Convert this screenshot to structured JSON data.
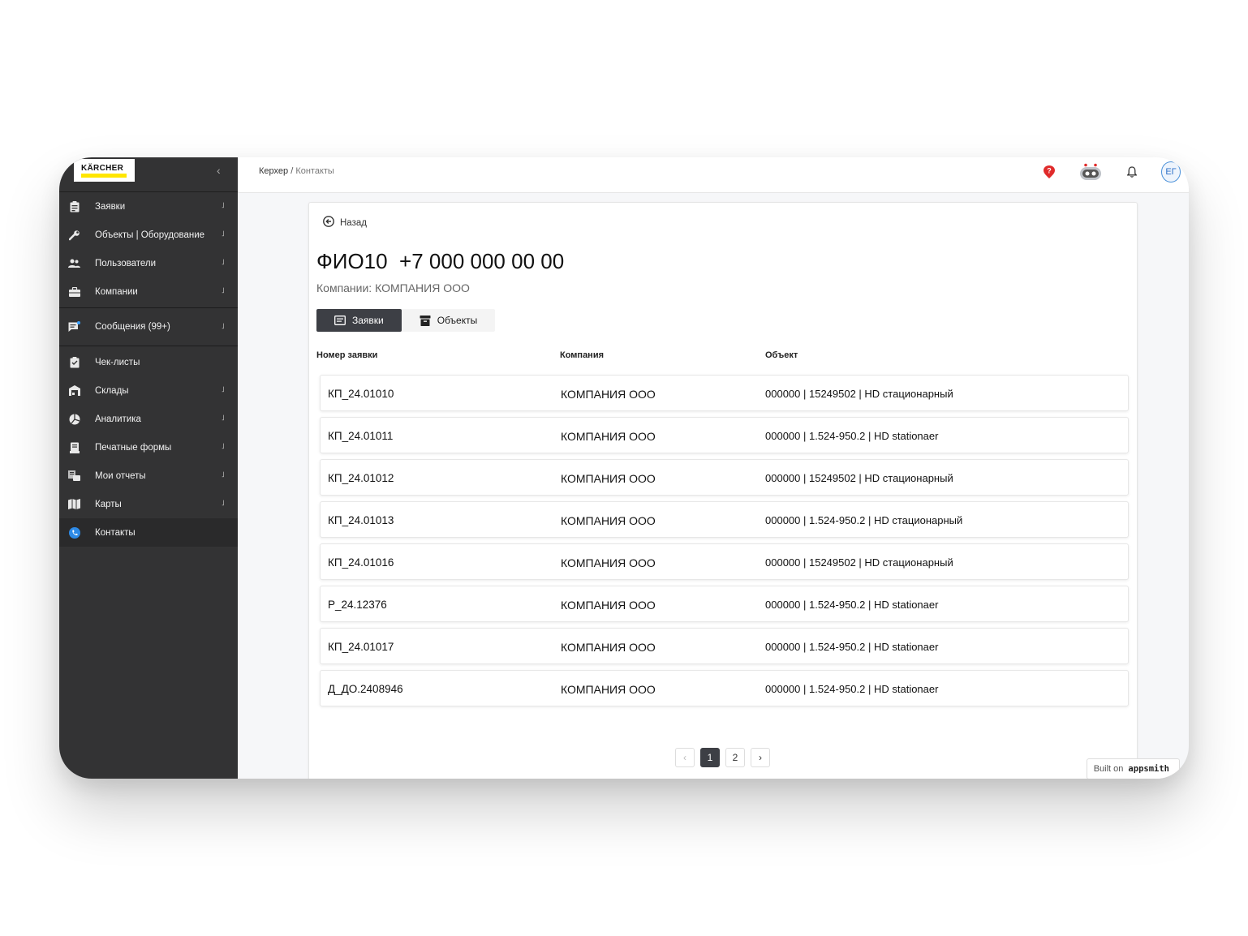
{
  "sidebar": {
    "logo": "KÄRCHER",
    "collapse": "‹",
    "items": [
      {
        "label": "Заявки",
        "icon": "clipboard-icon"
      },
      {
        "label": "Объекты | Оборудование",
        "icon": "wrench-icon"
      },
      {
        "label": "Пользователи",
        "icon": "users-icon"
      },
      {
        "label": "Компании",
        "icon": "briefcase-icon"
      }
    ],
    "messages": {
      "label": "Сообщения (99+)",
      "icon": "chat-icon"
    },
    "items2": [
      {
        "label": "Чек-листы",
        "icon": "checklist-icon"
      },
      {
        "label": "Склады",
        "icon": "warehouse-icon"
      },
      {
        "label": "Аналитика",
        "icon": "pie-chart-icon"
      },
      {
        "label": "Печатные формы",
        "icon": "print-icon"
      },
      {
        "label": "Мои отчеты",
        "icon": "report-icon"
      },
      {
        "label": "Карты",
        "icon": "map-icon"
      },
      {
        "label": "Контакты",
        "icon": "phone-icon"
      }
    ]
  },
  "header": {
    "breadcrumb_root": "Керхер",
    "breadcrumb_sep": " / ",
    "breadcrumb_current": "Контакты",
    "avatar": "ЕГ"
  },
  "content": {
    "back_label": "Назад",
    "title": "ФИО10  +7 000 000 00 00",
    "subtitle": "Компании: КОМПАНИЯ ООО",
    "tabs": [
      "Заявки",
      "Объекты"
    ],
    "columns": [
      "Номер заявки",
      "Компания",
      "Объект"
    ],
    "rows": [
      [
        "КП_24.01010",
        "КОМПАНИЯ ООО",
        "000000 | 15249502 | HD стационарный"
      ],
      [
        "КП_24.01011",
        "КОМПАНИЯ ООО",
        "000000 | 1.524-950.2 | HD stationaer"
      ],
      [
        "КП_24.01012",
        "КОМПАНИЯ ООО",
        "000000 | 15249502 | HD стационарный"
      ],
      [
        "КП_24.01013",
        "КОМПАНИЯ ООО",
        "000000 | 1.524-950.2 | HD стационарный"
      ],
      [
        "КП_24.01016",
        "КОМПАНИЯ ООО",
        "000000 | 15249502 | HD стационарный"
      ],
      [
        "Р_24.12376",
        "КОМПАНИЯ ООО",
        "000000 | 1.524-950.2 | HD stationaer"
      ],
      [
        "КП_24.01017",
        "КОМПАНИЯ ООО",
        "000000 | 1.524-950.2 | HD stationaer"
      ],
      [
        "Д_ДО.2408946",
        "КОМПАНИЯ ООО",
        "000000 | 1.524-950.2 | HD stationaer"
      ]
    ],
    "pagination": {
      "prev": "‹",
      "pages": [
        "1",
        "2"
      ],
      "current": "1",
      "next": "›"
    }
  },
  "built": {
    "prefix": "Built on",
    "brand": "appsmith"
  },
  "colors": {
    "sidebar": "#333334",
    "accent_dark": "#3d3f45",
    "logo_yellow": "#ffe600",
    "help_red": "#e02b2b",
    "phone_blue": "#2d8ae6"
  }
}
